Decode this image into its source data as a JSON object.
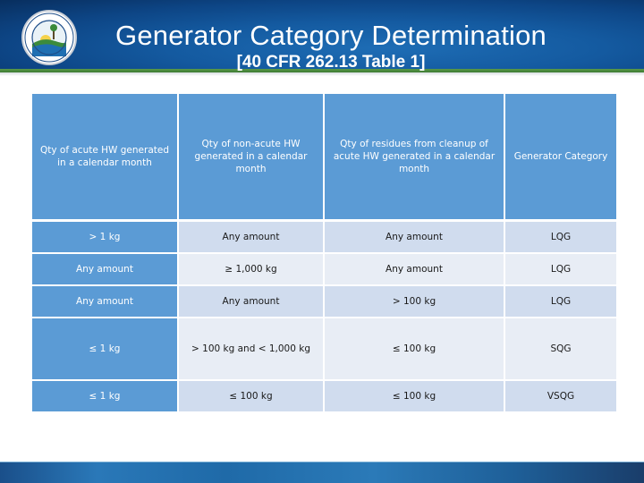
{
  "header": {
    "title": "Generator Category Determination",
    "subtitle": "[40 CFR 262.13 Table 1]",
    "logo": "florida-department-of-environmental-protection-logo"
  },
  "table": {
    "columns": [
      "Qty of acute HW generated in a calendar month",
      "Qty of non-acute HW generated in a calendar month",
      "Qty of residues from cleanup of acute HW generated in a calendar month",
      "Generator Category"
    ],
    "rows": [
      [
        "> 1 kg",
        "Any amount",
        "Any amount",
        "LQG"
      ],
      [
        "Any amount",
        "≥ 1,000 kg",
        "Any amount",
        "LQG"
      ],
      [
        "Any amount",
        "Any amount",
        "> 100 kg",
        "LQG"
      ],
      [
        "≤ 1 kg",
        "> 100 kg and < 1,000 kg",
        "≤ 100 kg",
        "SQG"
      ],
      [
        "≤ 1 kg",
        "≤ 100 kg",
        "≤ 100 kg",
        "VSQG"
      ]
    ]
  },
  "colors": {
    "header_blue": "#0d4585",
    "accent_green": "#4a8a3c",
    "table_header": "#5b9bd5",
    "row_band_dark": "#d0dcee",
    "row_band_light": "#e8edf5"
  }
}
